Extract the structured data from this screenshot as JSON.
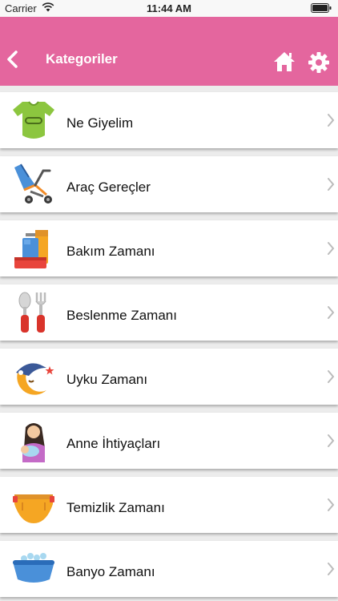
{
  "status_bar": {
    "carrier": "Carrier",
    "time": "11:44 AM"
  },
  "navbar": {
    "title": "Kategoriler",
    "back_icon": "chevron-left-icon",
    "home_icon": "home-icon",
    "settings_icon": "gear-icon",
    "background_color": "#e4669e"
  },
  "categories": [
    {
      "label": "Ne Giyelim",
      "icon": "baby-onesie-icon"
    },
    {
      "label": "Araç Gereçler",
      "icon": "stroller-icon"
    },
    {
      "label": "Bakım Zamanı",
      "icon": "care-products-icon"
    },
    {
      "label": "Beslenme Zamanı",
      "icon": "spoon-fork-icon"
    },
    {
      "label": "Uyku Zamanı",
      "icon": "sleeping-moon-icon"
    },
    {
      "label": "Anne İhtiyaçları",
      "icon": "mother-baby-icon"
    },
    {
      "label": "Temizlik Zamanı",
      "icon": "diaper-icon"
    },
    {
      "label": "Banyo Zamanı",
      "icon": "baby-bathtub-icon"
    }
  ]
}
